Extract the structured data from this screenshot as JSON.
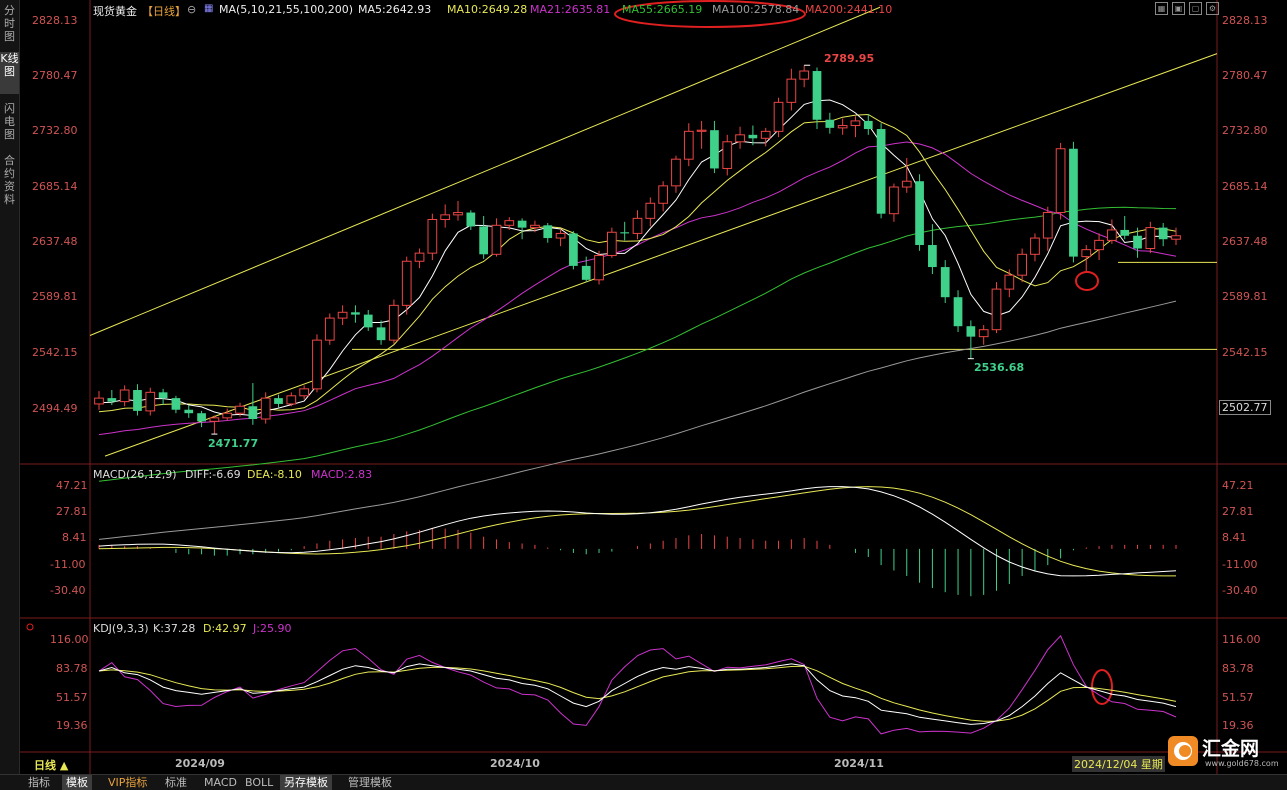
{
  "sidebar": {
    "items": [
      {
        "label": "分时图",
        "active": false
      },
      {
        "label": "K线图",
        "active": true
      },
      {
        "label": "闪电图",
        "active": false
      },
      {
        "label": "合约资料",
        "active": false
      }
    ]
  },
  "header": {
    "instrument": "现货黄金",
    "period": "【日线】",
    "ma_params": "MA(5,10,21,55,100,200)",
    "ma5": "MA5:2642.93",
    "ma10": "MA10:2649.28",
    "ma21": "MA21:2635.81",
    "ma55": "MA55:2665.19",
    "ma100": "MA100:2578.84",
    "ma200": "MA200:2441.10"
  },
  "price_axis": [
    "2828.13",
    "2780.47",
    "2732.80",
    "2685.14",
    "2637.48",
    "2589.81",
    "2542.15",
    "2494.49"
  ],
  "price_axis_left": [
    "2828.13",
    "2780.47",
    "2732.80",
    "2685.14",
    "2637.48",
    "2589.81",
    "2542.15",
    "2494.49"
  ],
  "last_price": "2502.77",
  "annotations": {
    "high": "2789.95",
    "low1": "2471.77",
    "low2": "2536.68"
  },
  "macd": {
    "title": "MACD(26,12,9)",
    "diff": "DIFF:-6.69",
    "dea": "DEA:-8.10",
    "macd": "MACD:2.83",
    "axis": [
      "47.21",
      "27.81",
      "8.41",
      "-11.00",
      "-30.40"
    ]
  },
  "kdj": {
    "title": "KDJ(9,3,3)",
    "k": "K:37.28",
    "d": "D:42.97",
    "j": "J:25.90",
    "axis": [
      "116.00",
      "83.78",
      "51.57",
      "19.36"
    ]
  },
  "dates": [
    "2024/09",
    "2024/10",
    "2024/11"
  ],
  "cursor_date": "2024/12/04 星期",
  "period_label": "日线 ▲",
  "logo": "汇金网",
  "logo_url": "www.gold678.com",
  "bottom_tabs": [
    {
      "label": "指标",
      "type": "normal"
    },
    {
      "label": "模板",
      "type": "active"
    },
    {
      "label": "VIP指标",
      "type": "vip"
    },
    {
      "label": "标准",
      "type": "normal"
    },
    {
      "label": "MACD",
      "type": "normal"
    },
    {
      "label": "BOLL",
      "type": "normal"
    },
    {
      "label": "另存模板",
      "type": "active"
    },
    {
      "label": "管理模板",
      "type": "normal"
    }
  ],
  "colors": {
    "up": "#ec4545",
    "down": "#3fd08a",
    "ma5": "#ffffff",
    "ma10": "#e8e855",
    "ma21": "#cc33cc",
    "ma55": "#33c033",
    "ma100": "#9a9a9a",
    "ma200": "#ec4545",
    "trend": "#e8e855",
    "axis_text": "#d05454"
  },
  "chart_data": {
    "type": "candlestick",
    "ylim": [
      2450,
      2840
    ],
    "candles": [
      [
        2498,
        2509,
        2493,
        2503
      ],
      [
        2503,
        2510,
        2497,
        2500
      ],
      [
        2500,
        2514,
        2496,
        2510
      ],
      [
        2510,
        2515,
        2488,
        2492
      ],
      [
        2492,
        2512,
        2488,
        2508
      ],
      [
        2508,
        2511,
        2497,
        2503
      ],
      [
        2503,
        2505,
        2490,
        2493
      ],
      [
        2493,
        2497,
        2486,
        2490
      ],
      [
        2490,
        2492,
        2478,
        2483
      ],
      [
        2483,
        2488,
        2472,
        2486
      ],
      [
        2486,
        2494,
        2484,
        2490
      ],
      [
        2490,
        2499,
        2487,
        2496
      ],
      [
        2496,
        2516,
        2480,
        2485
      ],
      [
        2485,
        2508,
        2481,
        2503
      ],
      [
        2503,
        2506,
        2495,
        2498
      ],
      [
        2498,
        2508,
        2496,
        2505
      ],
      [
        2505,
        2514,
        2502,
        2511
      ],
      [
        2511,
        2558,
        2508,
        2553
      ],
      [
        2553,
        2576,
        2549,
        2572
      ],
      [
        2572,
        2583,
        2566,
        2577
      ],
      [
        2577,
        2583,
        2568,
        2575
      ],
      [
        2575,
        2579,
        2561,
        2564
      ],
      [
        2564,
        2570,
        2549,
        2553
      ],
      [
        2553,
        2588,
        2550,
        2583
      ],
      [
        2583,
        2625,
        2575,
        2621
      ],
      [
        2621,
        2632,
        2615,
        2628
      ],
      [
        2628,
        2662,
        2622,
        2657
      ],
      [
        2657,
        2670,
        2650,
        2661
      ],
      [
        2661,
        2673,
        2656,
        2663
      ],
      [
        2663,
        2665,
        2648,
        2651
      ],
      [
        2651,
        2660,
        2623,
        2627
      ],
      [
        2627,
        2658,
        2625,
        2652
      ],
      [
        2652,
        2659,
        2648,
        2656
      ],
      [
        2656,
        2658,
        2640,
        2650
      ],
      [
        2650,
        2656,
        2646,
        2652
      ],
      [
        2652,
        2654,
        2637,
        2641
      ],
      [
        2641,
        2649,
        2634,
        2645
      ],
      [
        2645,
        2647,
        2614,
        2617
      ],
      [
        2617,
        2625,
        2603,
        2605
      ],
      [
        2605,
        2630,
        2601,
        2626
      ],
      [
        2626,
        2650,
        2624,
        2646
      ],
      [
        2646,
        2655,
        2639,
        2645
      ],
      [
        2645,
        2665,
        2640,
        2658
      ],
      [
        2658,
        2676,
        2651,
        2671
      ],
      [
        2671,
        2690,
        2664,
        2686
      ],
      [
        2686,
        2712,
        2680,
        2709
      ],
      [
        2709,
        2740,
        2703,
        2733
      ],
      [
        2733,
        2742,
        2718,
        2734
      ],
      [
        2734,
        2742,
        2697,
        2701
      ],
      [
        2701,
        2730,
        2695,
        2724
      ],
      [
        2724,
        2737,
        2718,
        2730
      ],
      [
        2730,
        2738,
        2721,
        2727
      ],
      [
        2727,
        2736,
        2720,
        2733
      ],
      [
        2733,
        2762,
        2728,
        2758
      ],
      [
        2758,
        2787,
        2751,
        2778
      ],
      [
        2778,
        2790,
        2771,
        2785
      ],
      [
        2785,
        2788,
        2735,
        2743
      ],
      [
        2743,
        2749,
        2731,
        2736
      ],
      [
        2736,
        2744,
        2730,
        2738
      ],
      [
        2738,
        2746,
        2728,
        2742
      ],
      [
        2742,
        2748,
        2730,
        2735
      ],
      [
        2735,
        2740,
        2658,
        2662
      ],
      [
        2662,
        2688,
        2655,
        2685
      ],
      [
        2685,
        2710,
        2680,
        2690
      ],
      [
        2690,
        2696,
        2630,
        2635
      ],
      [
        2635,
        2653,
        2610,
        2616
      ],
      [
        2616,
        2622,
        2585,
        2590
      ],
      [
        2590,
        2596,
        2560,
        2565
      ],
      [
        2565,
        2570,
        2537,
        2556
      ],
      [
        2556,
        2566,
        2549,
        2562
      ],
      [
        2562,
        2603,
        2559,
        2597
      ],
      [
        2597,
        2614,
        2590,
        2609
      ],
      [
        2609,
        2632,
        2603,
        2627
      ],
      [
        2627,
        2645,
        2621,
        2641
      ],
      [
        2641,
        2668,
        2630,
        2663
      ],
      [
        2663,
        2723,
        2657,
        2718
      ],
      [
        2718,
        2724,
        2620,
        2625
      ],
      [
        2625,
        2635,
        2612,
        2631
      ],
      [
        2631,
        2645,
        2622,
        2639
      ],
      [
        2639,
        2657,
        2636,
        2648
      ],
      [
        2648,
        2660,
        2640,
        2643
      ],
      [
        2643,
        2650,
        2624,
        2632
      ],
      [
        2632,
        2655,
        2628,
        2650
      ],
      [
        2650,
        2654,
        2634,
        2640
      ],
      [
        2640,
        2650,
        2635,
        2643
      ]
    ],
    "macd_hist": [
      3,
      3,
      2,
      2,
      1,
      0,
      -3,
      -4,
      -4,
      -5,
      -5,
      -4,
      -4,
      -3,
      -2,
      -1,
      2,
      4,
      6,
      7,
      8,
      9,
      9,
      11,
      13,
      14,
      15,
      15,
      14,
      12,
      9,
      7,
      5,
      4,
      3,
      1,
      -1,
      -3,
      -4,
      -3,
      -2,
      0,
      2,
      4,
      6,
      8,
      10,
      11,
      10,
      9,
      8,
      7,
      6,
      6,
      7,
      8,
      6,
      3,
      0,
      -3,
      -6,
      -12,
      -16,
      -20,
      -25,
      -29,
      -32,
      -34,
      -35,
      -34,
      -31,
      -26,
      -20,
      -16,
      -12,
      -7,
      -1,
      1,
      2,
      3,
      3,
      3,
      3,
      3,
      3
    ],
    "kdj_k": [
      80,
      84,
      78,
      76,
      70,
      62,
      58,
      56,
      54,
      56,
      58,
      60,
      55,
      56,
      58,
      60,
      62,
      68,
      75,
      82,
      86,
      84,
      80,
      78,
      85,
      88,
      86,
      84,
      82,
      80,
      76,
      72,
      70,
      66,
      64,
      60,
      52,
      44,
      40,
      46,
      58,
      66,
      74,
      80,
      84,
      82,
      85,
      83,
      80,
      82,
      82,
      83,
      84,
      86,
      88,
      86,
      70,
      58,
      52,
      50,
      46,
      36,
      34,
      32,
      28,
      26,
      24,
      22,
      20,
      21,
      24,
      30,
      40,
      52,
      66,
      78,
      70,
      62,
      58,
      54,
      52,
      48,
      46,
      44,
      40
    ]
  }
}
